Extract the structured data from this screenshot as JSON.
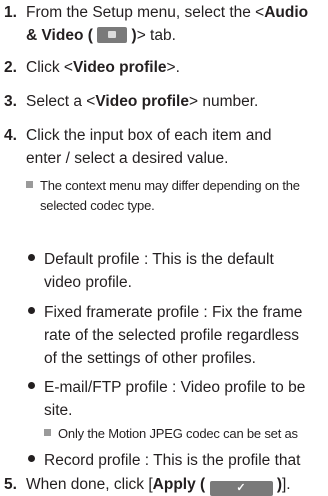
{
  "steps": [
    {
      "num": "1.",
      "line1_pre": "From the Setup menu, select the <",
      "line1_bold": "Audio",
      "line2_bold": "& Video (",
      "line2_bold_close": ")",
      "line2_post": "> tab."
    },
    {
      "num": "2.",
      "pre": "Click <",
      "bold": "Video profile",
      "post": ">."
    },
    {
      "num": "3.",
      "pre": "Select a <",
      "bold": "Video profile",
      "post": "> number."
    },
    {
      "num": "4.",
      "line1": "Click the input box of each item and",
      "line2": "enter / select a desired value."
    },
    {
      "num": "5.",
      "pre": "When done, click [",
      "bold": "Apply (",
      "bold_close": ")",
      "post": "]."
    }
  ],
  "note1": {
    "line1": "The context menu may differ depending on the",
    "line2": "selected codec type."
  },
  "bullets": {
    "default": {
      "line1": "Default profile : This is the default",
      "line2": "video profile."
    },
    "fixed": {
      "line1": "Fixed framerate profile : Fix the frame",
      "line2": "rate of the selected profile regardless",
      "line3": "of the settings of other profiles."
    },
    "email": {
      "line1": "E-mail/FTP profile : Video profile to be",
      "line2": "site."
    },
    "record": {
      "line1": "Record profile : This is the profile that"
    }
  },
  "note2": {
    "text": "Only the Motion JPEG codec can be set as"
  },
  "icons": {
    "av": "audio-video-tab-icon",
    "apply": "checkmark-icon"
  },
  "apply_glyph": "✓"
}
